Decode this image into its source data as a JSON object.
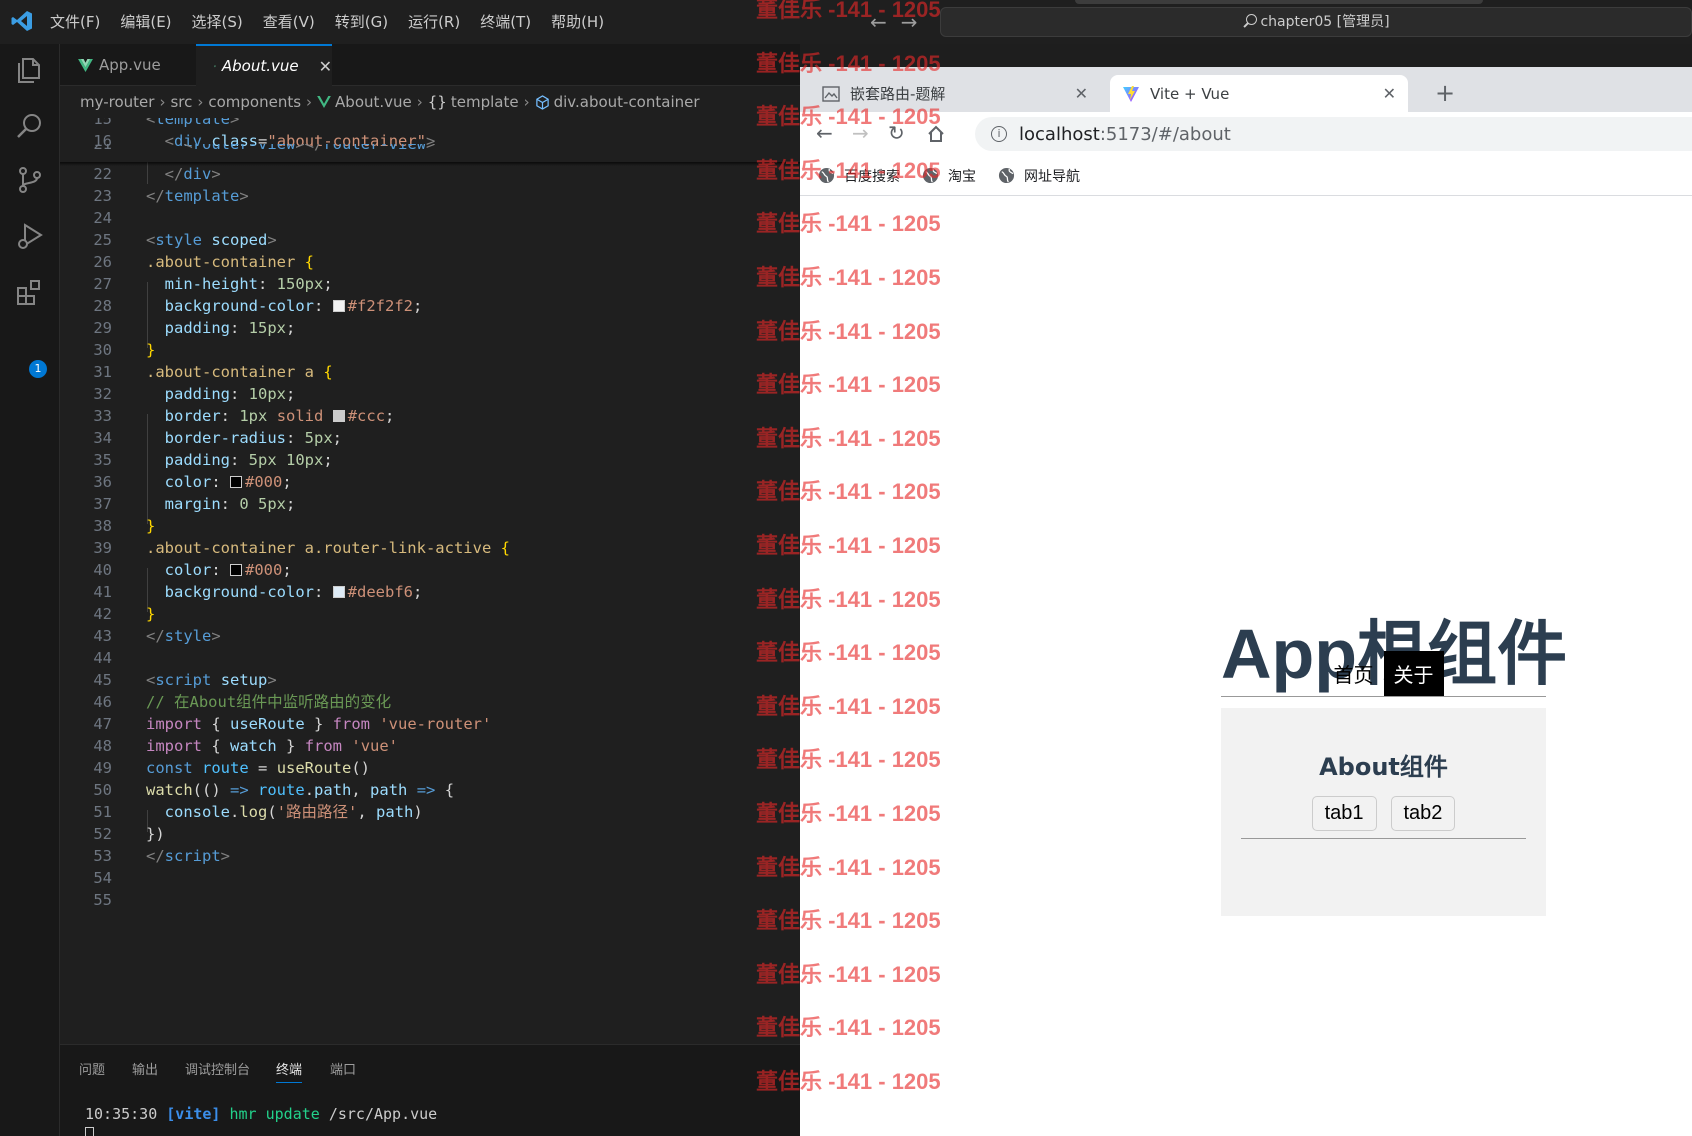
{
  "menubar": {
    "items": [
      "文件(F)",
      "编辑(E)",
      "选择(S)",
      "查看(V)",
      "转到(G)",
      "运行(R)",
      "终端(T)",
      "帮助(H)"
    ]
  },
  "command_center": {
    "text": "chapter05 [管理员]"
  },
  "activity_badge": "1",
  "tabs": [
    {
      "label": "App.vue",
      "active": false
    },
    {
      "label": "About.vue",
      "active": true
    }
  ],
  "tab_close_glyph": "✕",
  "breadcrumb": [
    "my-router",
    "src",
    "components",
    "About.vue",
    "template",
    "div.about-container"
  ],
  "editor": {
    "line_numbers": [
      "15",
      "16",
      "21",
      "22",
      "23",
      "24",
      "25",
      "26",
      "27",
      "28",
      "29",
      "30",
      "31",
      "32",
      "33",
      "34",
      "35",
      "36",
      "37",
      "38",
      "39",
      "40",
      "41",
      "42",
      "43",
      "44",
      "45",
      "46",
      "47",
      "48",
      "49",
      "50",
      "51",
      "52",
      "53",
      "54",
      "55"
    ]
  },
  "panel": {
    "tabs": [
      "问题",
      "输出",
      "调试控制台",
      "终端",
      "端口"
    ],
    "active_tab": "终端",
    "terminal": {
      "time": "10:35:30",
      "tag": "[vite]",
      "msg": "hmr update",
      "path": "/src/App.vue"
    }
  },
  "browser": {
    "tabs": [
      {
        "title": "嵌套路由-题解",
        "active": false
      },
      {
        "title": "Vite + Vue",
        "active": true
      }
    ],
    "url_host": "localhost",
    "url_rest": ":5173/#/about",
    "bookmarks": [
      "百度搜索",
      "淘宝",
      "网址导航"
    ],
    "page": {
      "heading": "App根组件",
      "nav": [
        {
          "label": "首页",
          "active": false
        },
        {
          "label": "关于",
          "active": true
        }
      ],
      "about_title": "About组件",
      "about_tabs": [
        "tab1",
        "tab2"
      ]
    }
  },
  "watermark": {
    "text": "董佳乐 -141 - 1205",
    "count": 21
  },
  "colors": {
    "accent": "#0078d4",
    "editor_bg": "#1f1f1f",
    "about_bg": "#f2f2f2",
    "heading": "#2c3e50",
    "watermark": "#e62828"
  }
}
